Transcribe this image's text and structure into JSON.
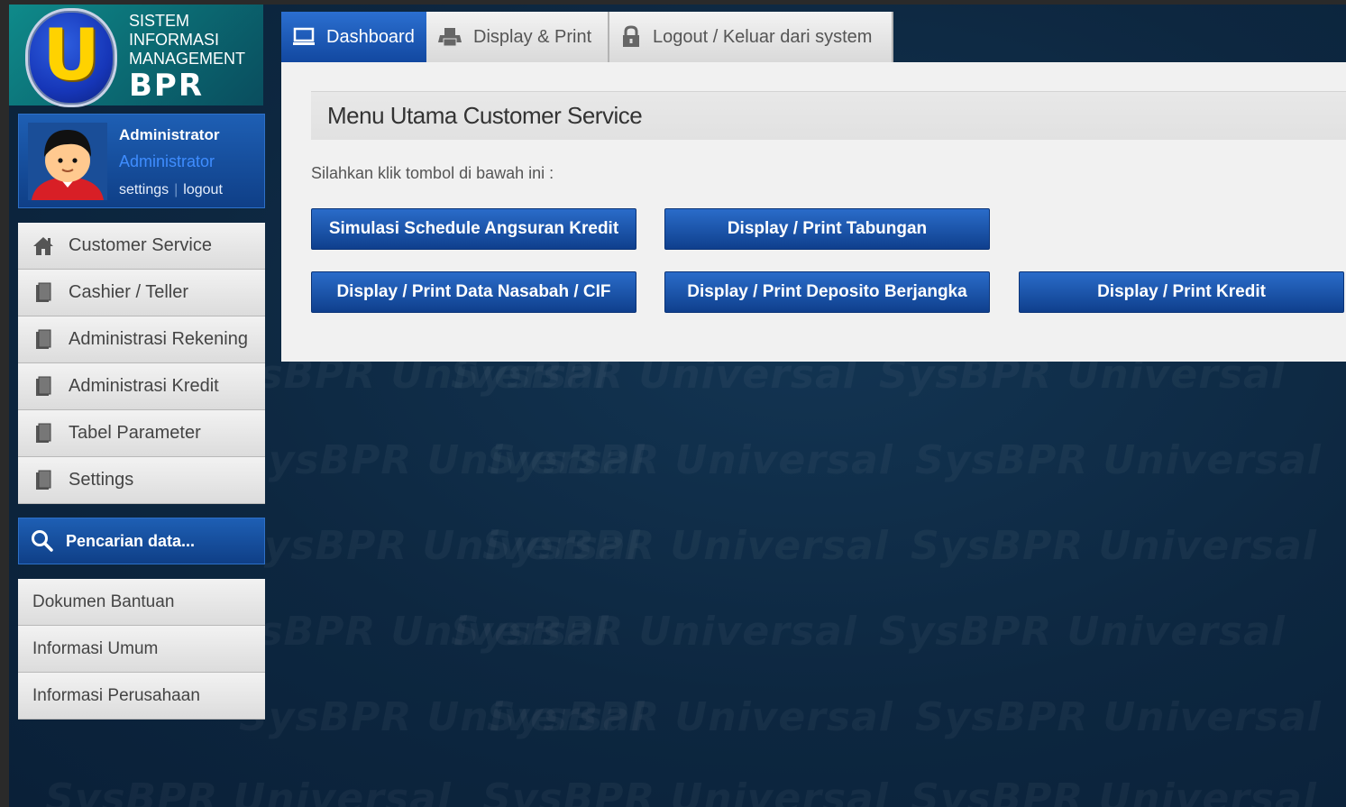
{
  "logo": {
    "letter": "U",
    "lines": [
      "SISTEM",
      "INFORMASI",
      "MANAGEMENT"
    ],
    "brand": "BPR"
  },
  "user": {
    "name": "Administrator",
    "role": "Administrator",
    "settings_link": "settings",
    "separator": "|",
    "logout_link": "logout"
  },
  "menu": {
    "items": [
      {
        "label": "Customer Service",
        "icon": "home-icon"
      },
      {
        "label": "Cashier / Teller",
        "icon": "document-icon"
      },
      {
        "label": "Administrasi Rekening",
        "icon": "document-icon"
      },
      {
        "label": "Administrasi Kredit",
        "icon": "document-icon"
      },
      {
        "label": "Tabel Parameter",
        "icon": "document-icon"
      },
      {
        "label": "Settings",
        "icon": "document-icon"
      }
    ]
  },
  "search": {
    "label": "Pencarian data...",
    "icon": "search-icon"
  },
  "menu2": {
    "items": [
      "Dokumen Bantuan",
      "Informasi Umum",
      "Informasi Perusahaan"
    ]
  },
  "tabs": [
    {
      "label": "Dashboard",
      "icon": "monitor-icon",
      "active": true
    },
    {
      "label": "Display & Print",
      "icon": "printer-icon",
      "active": false
    },
    {
      "label": "Logout / Keluar dari system",
      "icon": "lock-icon",
      "active": false
    }
  ],
  "panel": {
    "title": "Menu Utama Customer Service",
    "hint": "Silahkan klik tombol di bawah ini :",
    "buttons": [
      "Simulasi Schedule Angsuran Kredit",
      "Display / Print Tabungan",
      "Display / Print Data Nasabah / CIF",
      "Display / Print Deposito Berjangka",
      "Display / Print Kredit"
    ]
  },
  "watermark": "SysBPR Universal",
  "colors": {
    "background": "#0d2740",
    "accent_blue": "#1e5fb4",
    "logo_yellow": "#ffd200",
    "panel": "#f1f1f1"
  }
}
